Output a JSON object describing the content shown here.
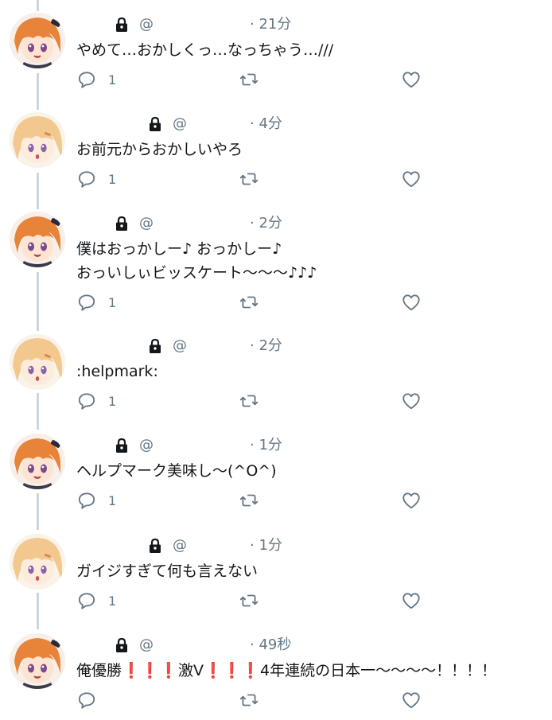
{
  "tweets": [
    {
      "avatar": "orange-hair-character-avatar",
      "handle_prefix": "@",
      "time": "· 21分",
      "text": "やめて…おかしくっ…なっちゃう…///",
      "reply_count": "1"
    },
    {
      "avatar": "blonde-hair-character-avatar",
      "handle_prefix": "@",
      "time": "· 4分",
      "text": "お前元からおかしいやろ",
      "reply_count": "1"
    },
    {
      "avatar": "orange-hair-character-avatar",
      "handle_prefix": "@",
      "time": "· 2分",
      "text": "僕はおっかしー♪ おっかしー♪\nおっいしぃビッスケート～～～♪♪♪",
      "reply_count": "1"
    },
    {
      "avatar": "blonde-hair-character-avatar",
      "handle_prefix": "@",
      "time": "· 2分",
      "text": ":helpmark:",
      "reply_count": "1"
    },
    {
      "avatar": "orange-hair-character-avatar",
      "handle_prefix": "@",
      "time": "· 1分",
      "text": "ヘルプマーク美味し～(^O^)",
      "reply_count": "1"
    },
    {
      "avatar": "blonde-hair-character-avatar",
      "handle_prefix": "@",
      "time": "· 1分",
      "text": "ガイジすぎて何も言えない",
      "reply_count": "1"
    },
    {
      "avatar": "orange-hair-character-avatar",
      "handle_prefix": "@",
      "time": "· 49秒",
      "text_parts": [
        "俺優勝",
        "❗❗❗",
        "激V",
        "❗❗❗",
        "4年連続の日本一～～～～！！！！"
      ],
      "reply_count": ""
    }
  ],
  "colors": {
    "meta": "#657786",
    "text": "#14171a",
    "thread_line": "#ccd6dd",
    "exclamation": "#e0245e"
  },
  "icons": {
    "lock": "lock-icon",
    "reply": "reply-icon",
    "retweet": "retweet-icon",
    "like": "heart-icon"
  }
}
